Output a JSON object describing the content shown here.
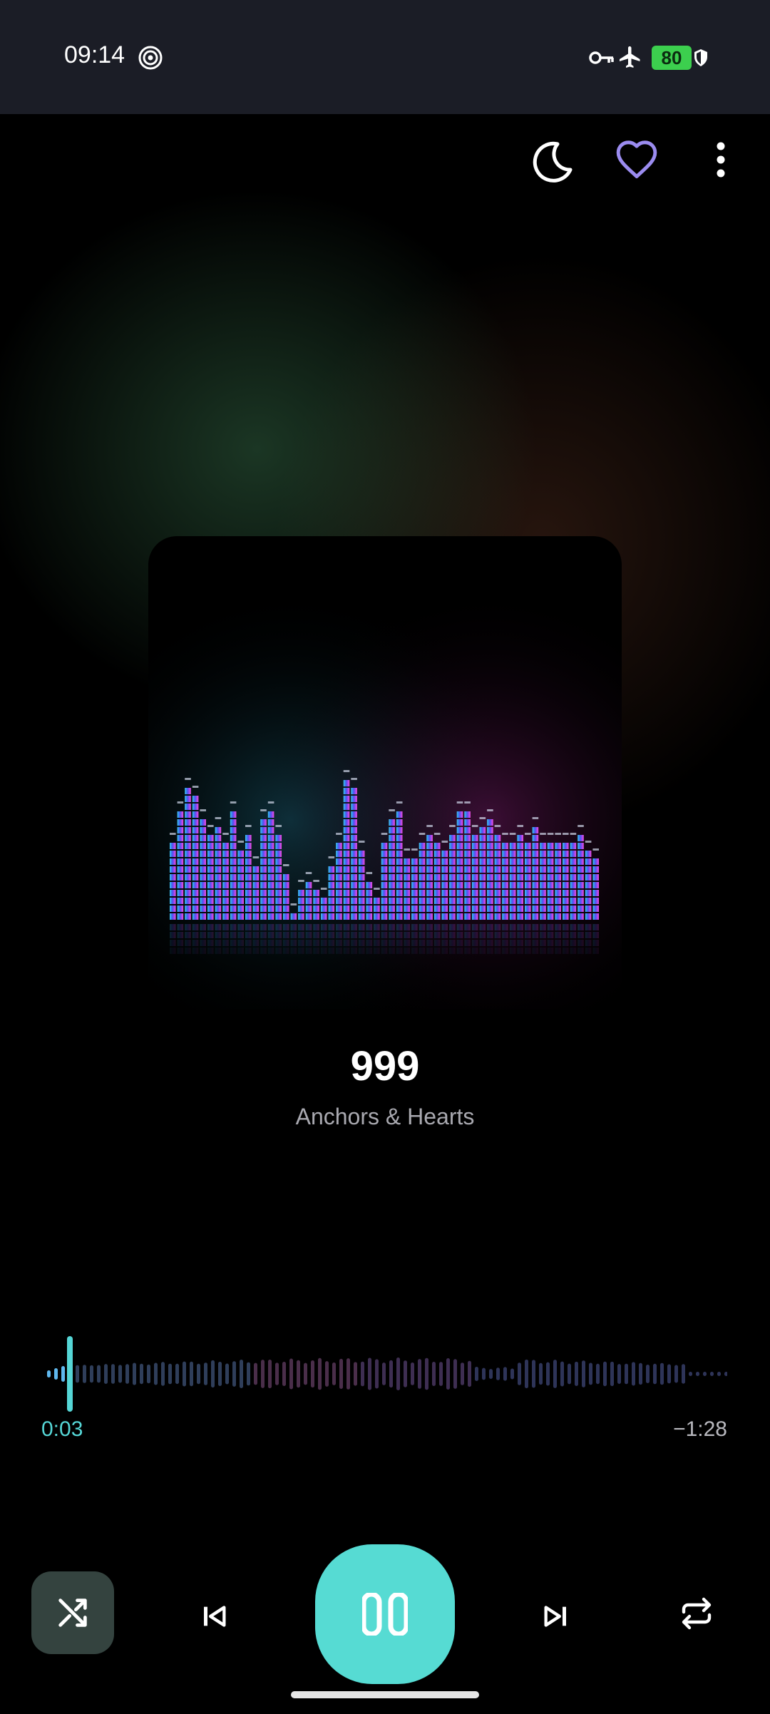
{
  "status_bar": {
    "time": "09:14",
    "battery_level": "80",
    "icons": [
      "hotspot-icon",
      "vpn-key-icon",
      "airplane-mode-icon",
      "battery-icon",
      "shield-icon"
    ]
  },
  "top_actions": {
    "icons": [
      "sleep-timer-moon-icon",
      "favorite-heart-icon",
      "more-options-icon"
    ],
    "favorite_color": "#9b8cf0"
  },
  "track": {
    "title": "999",
    "artist": "Anchors & Hearts"
  },
  "progress": {
    "elapsed": "0:03",
    "remaining": "−1:28",
    "fraction": 0.033,
    "accent_color": "#55d6d6"
  },
  "controls": {
    "icons": [
      "shuffle-icon",
      "previous-track-icon",
      "pause-icon",
      "next-track-icon",
      "repeat-icon"
    ],
    "shuffle_active": true,
    "play_button_color": "#56dbd3"
  }
}
